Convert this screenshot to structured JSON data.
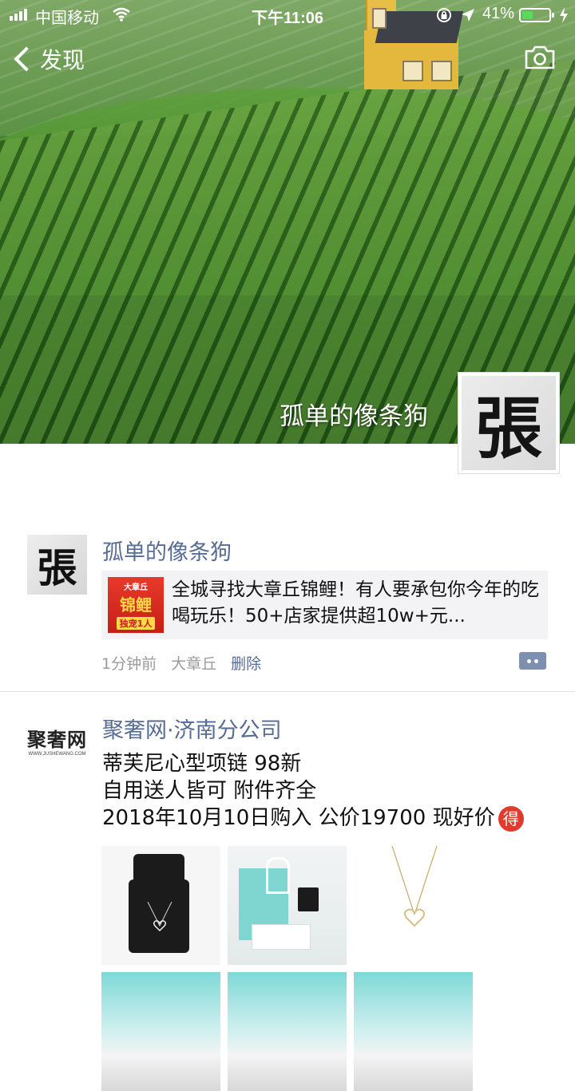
{
  "status_bar": {
    "carrier": "中国移动",
    "time": "下午11:06",
    "battery_percent": "41%",
    "battery_level": 0.41
  },
  "nav": {
    "back_label": "发现"
  },
  "profile": {
    "name": "孤单的像条狗",
    "avatar_char": "張"
  },
  "posts": [
    {
      "author": "孤单的像条狗",
      "avatar_char": "張",
      "link": {
        "thumb_top": "大章丘",
        "thumb_main": "锦鲤",
        "thumb_bottom": "独宠1人",
        "text": "全城寻找大章丘锦鲤！有人要承包你今年的吃喝玩乐！50+店家提供超10w+元..."
      },
      "time": "1分钟前",
      "location": "大章丘",
      "delete_label": "删除"
    },
    {
      "author": "聚奢网·济南分公司",
      "avatar_logo": "聚奢网",
      "avatar_logo_sub": "WWW.JUSHEWANG.COM",
      "lines": [
        "蒂芙尼心型项链 98新",
        "自用送人皆可 附件齐全",
        "2018年10月10日购入 公价19700 现好价"
      ],
      "emoji_badge": "得"
    }
  ],
  "colors": {
    "link_blue": "#576b95",
    "battery_green": "#5bd95c"
  }
}
